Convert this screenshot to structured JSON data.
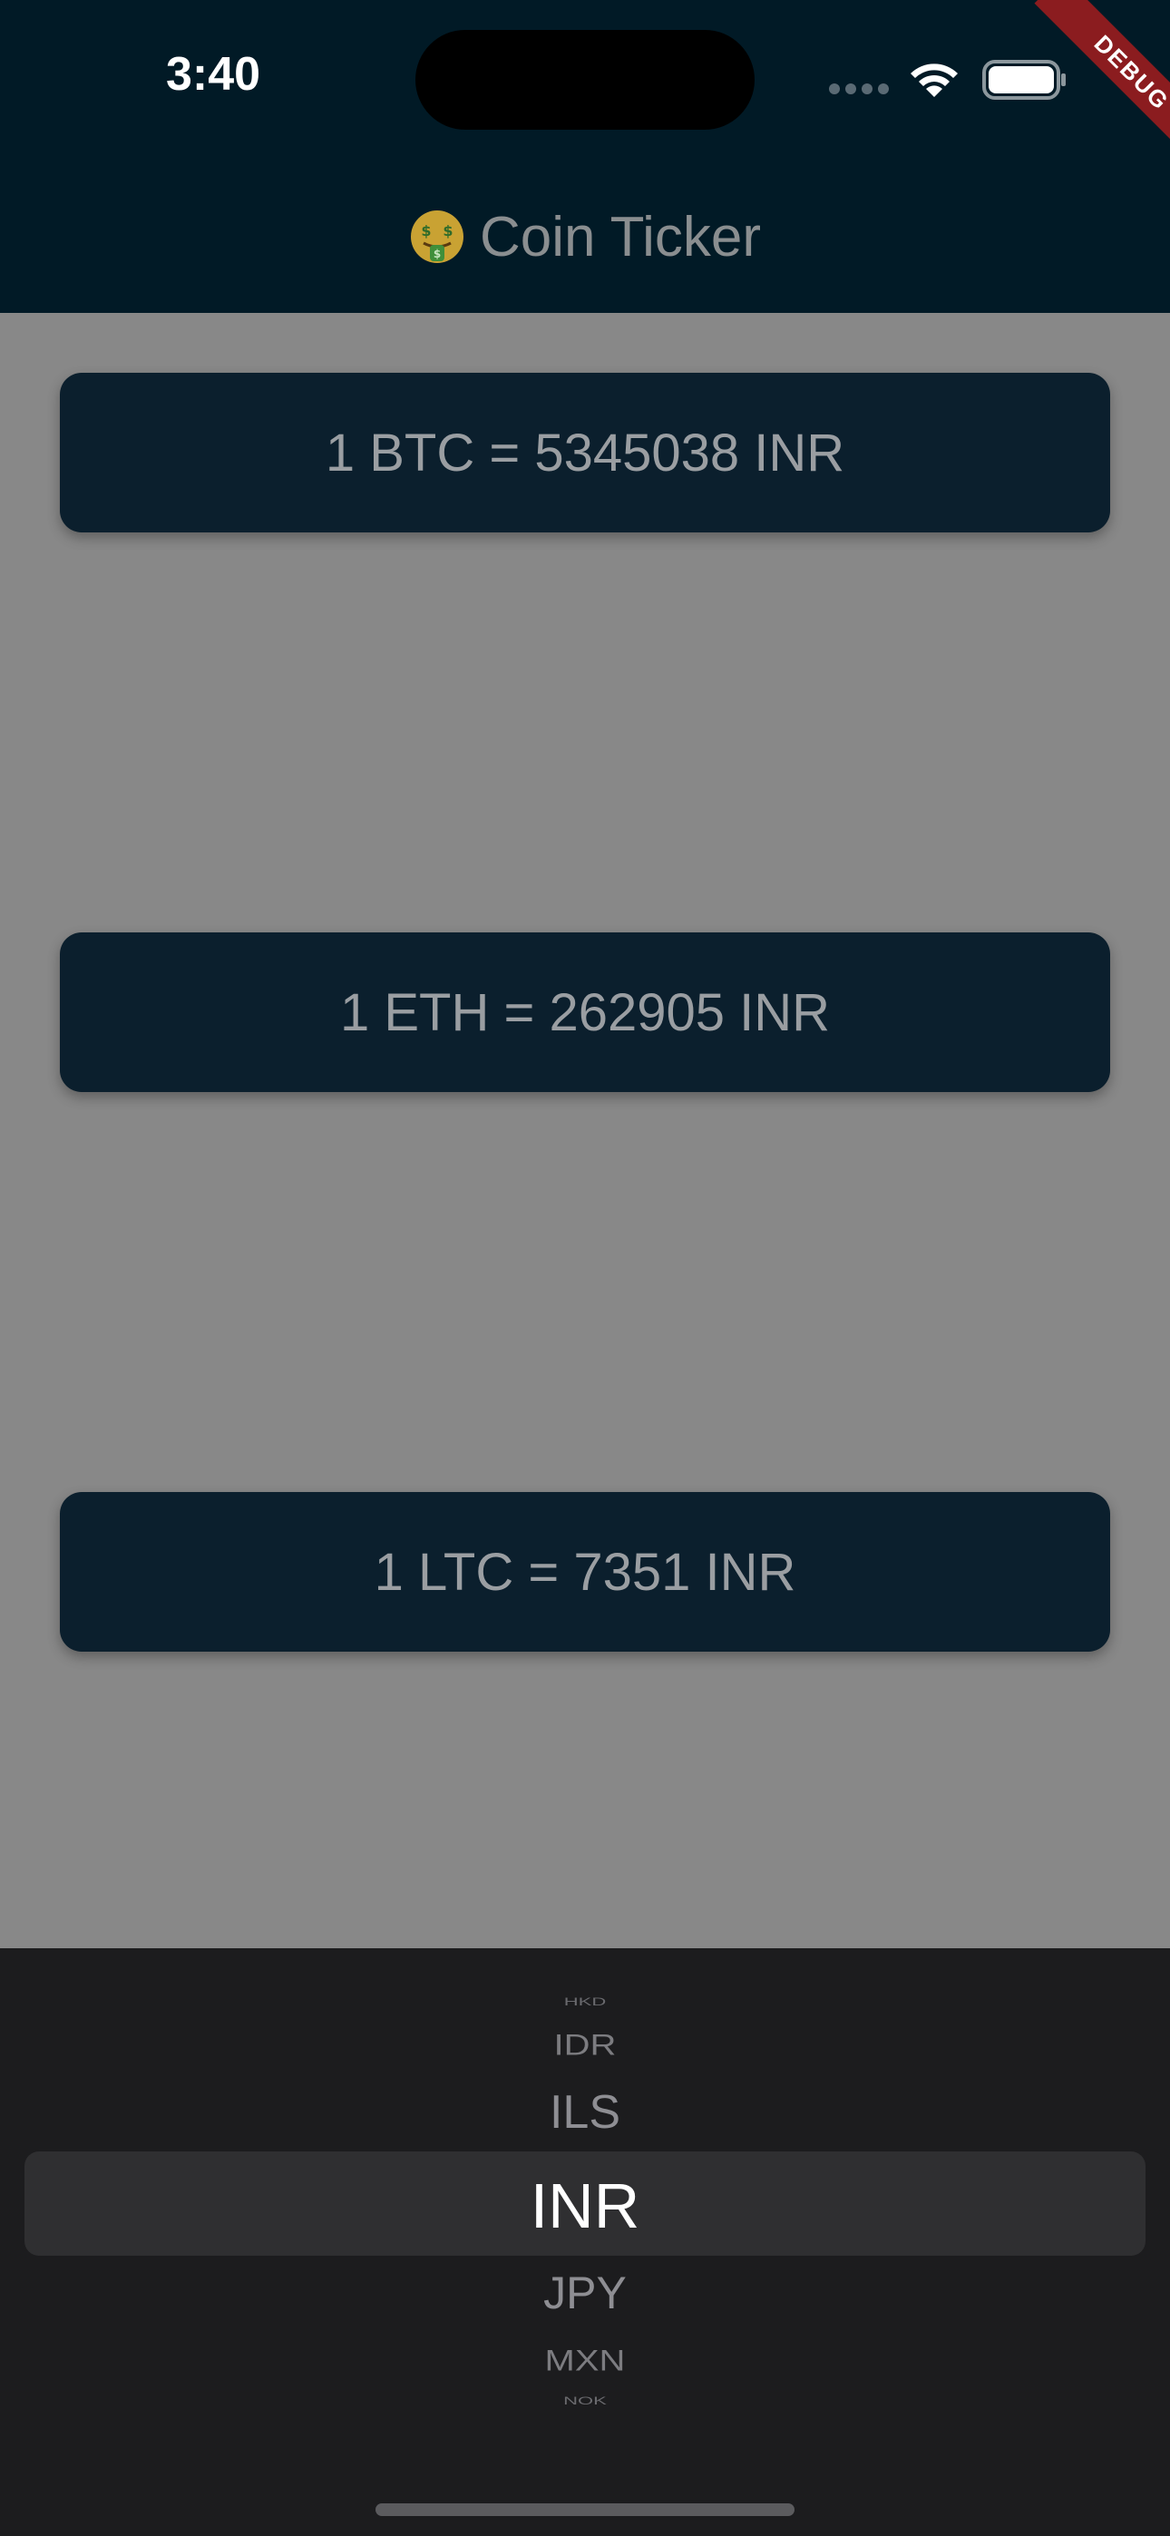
{
  "status_bar": {
    "time": "3:40"
  },
  "debug_banner": {
    "label": "DEBUG",
    "color": "#8b1c1f"
  },
  "app_bar": {
    "title": "Coin Ticker",
    "title_icon": "money-mouth-face-icon",
    "background": "#011a26"
  },
  "rates": [
    {
      "coin": "BTC",
      "label": "1 BTC = 5345038 INR"
    },
    {
      "coin": "ETH",
      "label": "1 ETH = 262905 INR"
    },
    {
      "coin": "LTC",
      "label": "1 LTC = 7351 INR"
    }
  ],
  "currency_picker": {
    "visible_options": [
      "HKD",
      "IDR",
      "ILS",
      "INR",
      "JPY",
      "MXN",
      "NOK"
    ],
    "selected": "INR"
  },
  "colors": {
    "card_background": "#0b1f2d",
    "page_background": "#888888",
    "picker_background": "#1c1c1e"
  }
}
